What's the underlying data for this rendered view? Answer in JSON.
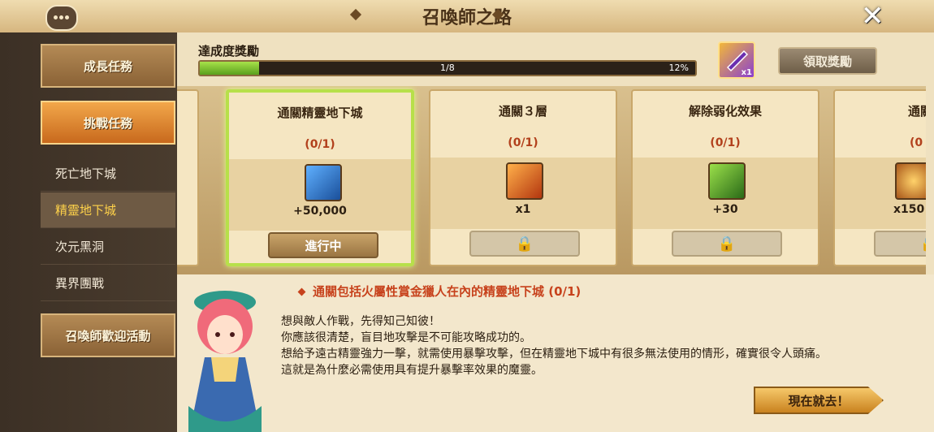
{
  "title": "召喚師之路",
  "sidebar": {
    "tabs": [
      {
        "label": "成長任務"
      },
      {
        "label": "挑戰任務"
      },
      {
        "label": "召喚師歡迎活動"
      }
    ],
    "subs": [
      {
        "label": "死亡地下城"
      },
      {
        "label": "精靈地下城"
      },
      {
        "label": "次元黑洞"
      },
      {
        "label": "異界團戰"
      }
    ]
  },
  "achievement": {
    "label": "達成度獎勵",
    "progress_text": "1/8",
    "percent_text": "12%",
    "percent": 12,
    "reward_qty": "x1",
    "claim_label": "領取獎勵"
  },
  "cards": [
    {
      "title": "通關精靈地下城",
      "progress": "(0/1)",
      "amount": "+50,000",
      "button": "進行中",
      "icon": "crystal-icon",
      "color": "#2c6fd1"
    },
    {
      "title": "通關３層",
      "progress": "(0/1)",
      "amount": "x1",
      "button": "lock",
      "icon": "scroll-icon",
      "color": "#d35a1a"
    },
    {
      "title": "解除弱化效果",
      "progress": "(0/1)",
      "amount": "+30",
      "button": "lock",
      "icon": "energy-icon",
      "color": "#3f9a2a"
    },
    {
      "title": "通關",
      "progress": "(0",
      "amount": "x150",
      "button": "lock",
      "icon": "rune-icon",
      "color": "#c9821f"
    }
  ],
  "quest": {
    "line": "通關包括火屬性賞金獵人在內的精靈地下城 (0/1)",
    "text1": "想與敵人作戰，先得知己知彼！",
    "text2": "你應該很清楚，盲目地攻擊是不可能攻略成功的。",
    "text3": "想給予遠古精靈強力一擊，就需使用暴擊攻擊，但在精靈地下城中有很多無法使用的情形，確實很令人頭痛。",
    "text4": "這就是為什麼必需使用具有提升暴擊率效果的魔靈。",
    "go_label": "現在就去！"
  }
}
